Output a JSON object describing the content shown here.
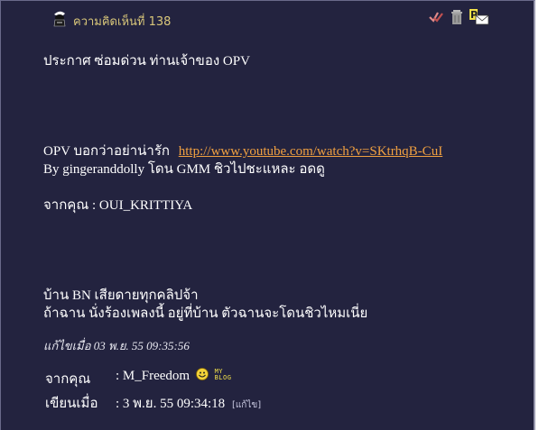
{
  "header": {
    "comment_number_label": "ความคิดเห็นที่ 138",
    "icons": [
      "avatar-icon",
      "check-icon",
      "trash-icon",
      "private-message-icon"
    ]
  },
  "post": {
    "lines": [
      "ประกาศ ซ่อมด่วน ท่านเจ้าของ OPV",
      "OPV บอกว่าอย่าน่ารัก",
      "By gingeranddolly โดน GMM ชิวไปชะแหละ อดดู",
      "จากคุณ : OUI_KRITTIYA",
      "บ้าน BN เสียดายทุกคลิปจ้า",
      "ถ้าฉาน นั่งร้องเพลงนี้ อยู่ที่บ้าน ตัวฉานจะโดนชิวไหมเนี่ย"
    ],
    "link_text": "http://www.youtube.com/watch?v=SKtrhqB-CuI"
  },
  "edited_note": "แก้ไขเมื่อ 03 พ.ย. 55 09:35:56",
  "meta": {
    "from_label": "จากคุณ",
    "from_value": ": M_Freedom",
    "myblog_line1": "MY",
    "myblog_line2": "BLOG",
    "posted_label": "เขียนเมื่อ",
    "posted_value": ": 3 พ.ย. 55 09:34:18",
    "edit_link": "[แก้ไข]"
  },
  "colors": {
    "background": "#23233f",
    "header_text": "#d9c77a",
    "link": "#f0a040"
  }
}
